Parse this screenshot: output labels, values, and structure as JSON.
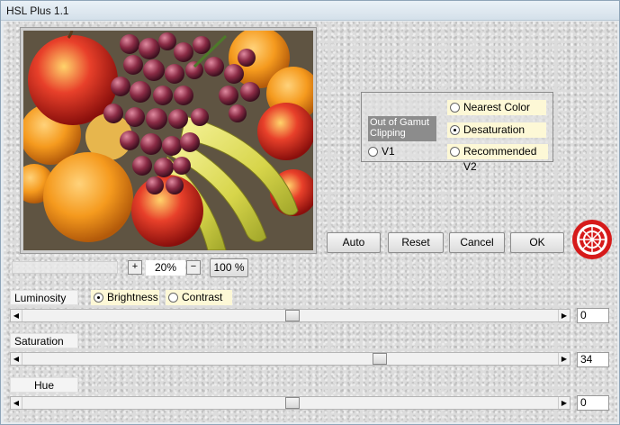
{
  "window": {
    "title": "HSL Plus 1.1"
  },
  "gamut": {
    "label": "Out of Gamut Clipping",
    "options": [
      {
        "label": "Nearest Color",
        "selected": false
      },
      {
        "label": "Desaturation",
        "selected": true
      },
      {
        "label": "Recommended V2",
        "selected": false
      }
    ],
    "v1": {
      "label": "V1",
      "selected": false
    }
  },
  "buttons": {
    "auto": "Auto",
    "reset": "Reset",
    "cancel": "Cancel",
    "ok": "OK"
  },
  "zoom": {
    "plus": "+",
    "minus": "−",
    "value": "20%",
    "full": "100 %"
  },
  "luminosity": {
    "label": "Luminosity",
    "brightness_label": "Brightness",
    "contrast_label": "Contrast",
    "selected": "Brightness",
    "value": "0"
  },
  "saturation": {
    "label": "Saturation",
    "value": "34"
  },
  "hue": {
    "label": "Hue",
    "value": "0"
  },
  "icons": {
    "scroll_left": "◀",
    "scroll_right": "▶"
  }
}
